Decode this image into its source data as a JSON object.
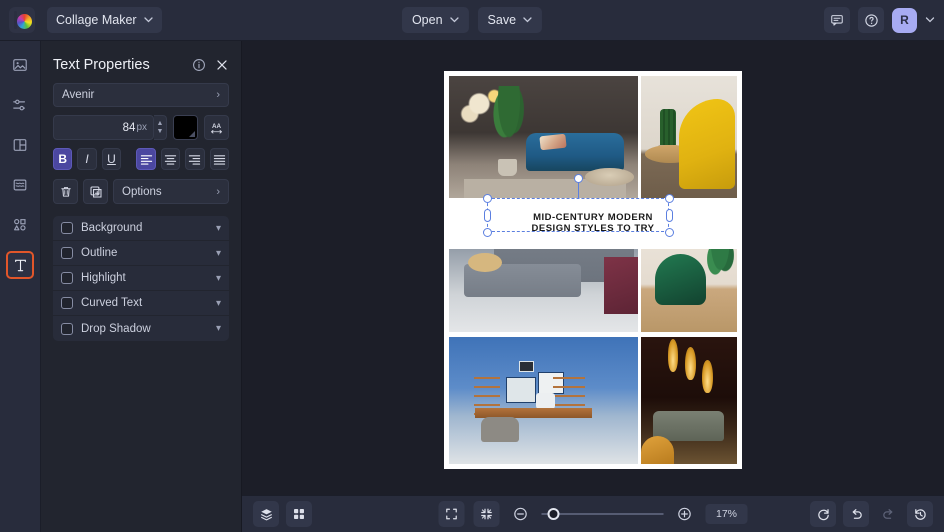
{
  "app": {
    "logo_name": "befunky-logo",
    "document_name": "Collage Maker"
  },
  "topbar": {
    "open_label": "Open",
    "save_label": "Save",
    "chat_icon": "chat-icon",
    "help_icon": "help-icon",
    "avatar_initial": "R"
  },
  "rail": {
    "items": [
      {
        "name": "image-manager",
        "icon": "image-icon"
      },
      {
        "name": "edit-adjust",
        "icon": "sliders-icon"
      },
      {
        "name": "layouts",
        "icon": "layout-grid-icon"
      },
      {
        "name": "backgrounds",
        "icon": "layers-stack-icon"
      },
      {
        "name": "graphics",
        "icon": "shapes-icon"
      },
      {
        "name": "text",
        "icon": "text-t-icon",
        "active": true
      }
    ]
  },
  "panel": {
    "title": "Text Properties",
    "info_icon": "info-icon",
    "close_icon": "close-icon",
    "font_family": "Avenir",
    "font_size": "84",
    "font_size_unit": "px",
    "color_swatch": "#000000",
    "letter_spacing_icon": "letter-spacing-icon",
    "style_buttons": [
      {
        "name": "bold-button",
        "label": "B",
        "active": true
      },
      {
        "name": "italic-button",
        "label": "I",
        "active": false
      },
      {
        "name": "underline-button",
        "label": "U",
        "active": false
      }
    ],
    "align_buttons": [
      {
        "name": "align-left-button",
        "active": true
      },
      {
        "name": "align-center-button",
        "active": false
      },
      {
        "name": "align-right-button",
        "active": false
      },
      {
        "name": "align-justify-button",
        "active": false
      }
    ],
    "delete_icon": "trash-icon",
    "duplicate_icon": "duplicate-icon",
    "options_label": "Options",
    "accordion": [
      {
        "label": "Background",
        "checked": false
      },
      {
        "label": "Outline",
        "checked": false
      },
      {
        "label": "Highlight",
        "checked": false
      },
      {
        "label": "Curved Text",
        "checked": false
      },
      {
        "label": "Drop Shadow",
        "checked": false
      }
    ]
  },
  "canvas": {
    "text_layer": {
      "line1": "MID-CENTURY MODERN",
      "line2": "DESIGN STYLES TO TRY",
      "selected": true
    },
    "photos": [
      {
        "name": "living-room-blue-sofa"
      },
      {
        "name": "yellow-armchair"
      },
      {
        "name": "grey-sectional-sofa"
      },
      {
        "name": "green-velvet-chair"
      },
      {
        "name": "blue-wall-office"
      },
      {
        "name": "dark-room-pendant-lights"
      }
    ]
  },
  "bottombar": {
    "layers_icon": "layers-icon",
    "grid_icon": "grid-icon",
    "fullscreen_icon": "fullscreen-icon",
    "fit-screen_icon": "fit-screen-icon",
    "zoom_out_icon": "zoom-out-icon",
    "zoom_in_icon": "zoom-in-icon",
    "zoom_value": "17%",
    "reset_icon": "reset-icon",
    "undo_icon": "undo-icon",
    "redo_icon": "redo-icon",
    "history_icon": "history-icon"
  },
  "colors": {
    "topbar_bg": "#282c3c",
    "panel_bg": "#22252f",
    "canvas_bg": "#1c1e28",
    "accent_purple": "#4b47a0",
    "active_orange": "#e2562a",
    "avatar_purple": "#a7abf2",
    "selection_blue": "#5b7fe0"
  }
}
